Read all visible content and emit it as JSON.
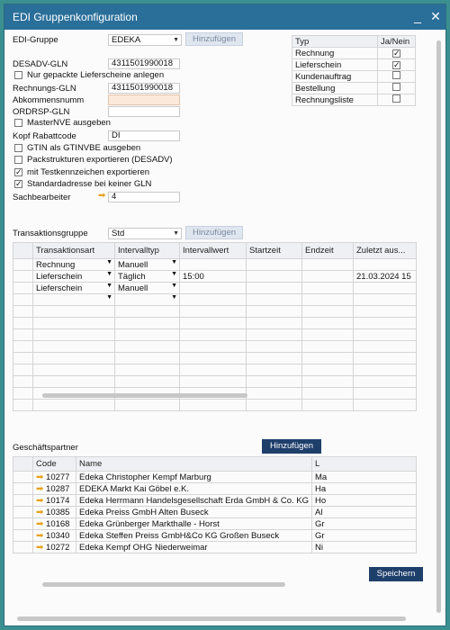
{
  "window": {
    "title": "EDI Gruppenkonfiguration",
    "minimize_glyph": "_",
    "close_glyph": "✕"
  },
  "form": {
    "edi_gruppe_label": "EDI-Gruppe",
    "edi_gruppe_value": "EDEKA",
    "hinzufuegen1": "Hinzufügen",
    "desadv_label": "DESADV-GLN",
    "desadv_value": "4311501990018",
    "nur_gepackte": "Nur gepackte Lieferscheine anlegen",
    "rechnungs_label": "Rechnungs-GLN",
    "rechnungs_value": "4311501990018",
    "abkommen_label": "Abkommensnumm",
    "abkommen_value": "",
    "ordrsp_label": "ORDRSP-GLN",
    "ordrsp_value": "",
    "masternve": "MasterNVE ausgeben",
    "kopf_label": "Kopf Rabattcode",
    "kopf_value": "DI",
    "gtin": "GTIN als GTINVBE ausgeben",
    "packstrukturen": "Packstrukturen exportieren (DESADV)",
    "testkennzeichen": "mit Testkennzeichen exportieren",
    "standardadresse": "Standardadresse bei keiner GLN",
    "sachbearbeiter_label": "Sachbearbeiter",
    "sachbearbeiter_value": "4"
  },
  "typ_table": {
    "headers": [
      "Typ",
      "Ja/Nein"
    ],
    "rows": [
      {
        "typ": "Rechnung",
        "check": "✓"
      },
      {
        "typ": "Lieferschein",
        "check": "✓"
      },
      {
        "typ": "Kundenauftrag",
        "check": ""
      },
      {
        "typ": "Bestellung",
        "check": ""
      },
      {
        "typ": "Rechnungsliste",
        "check": ""
      }
    ]
  },
  "transaktion": {
    "label": "Transaktionsgruppe",
    "value": "Std",
    "hinzufuegen": "Hinzufügen",
    "headers": [
      "Transaktionsart",
      "Intervalltyp",
      "Intervallwert",
      "Startzeit",
      "Endzeit",
      "Zuletzt aus..."
    ],
    "rows": [
      [
        "Rechnung",
        "Manuell",
        "",
        "",
        "",
        ""
      ],
      [
        "Lieferschein",
        "Täglich",
        "15:00",
        "",
        "",
        "21.03.2024 15"
      ],
      [
        "Lieferschein",
        "Manuell",
        "",
        "",
        "",
        ""
      ],
      [
        "",
        "",
        "",
        "",
        "",
        ""
      ]
    ]
  },
  "partner": {
    "label": "Geschäftspartner",
    "hinzufuegen": "Hinzufügen",
    "headers": [
      "Code",
      "Name",
      "L"
    ],
    "rows": [
      [
        "10277",
        "Edeka Christopher Kempf Marburg",
        "Ma"
      ],
      [
        "10287",
        "EDEKA Markt Kai Göbel e.K.",
        "Ha"
      ],
      [
        "10174",
        "Edeka Herrmann Handelsgesellschaft Erda GmbH & Co. KG",
        "Ho"
      ],
      [
        "10385",
        "Edeka Preiss GmbH Alten Buseck",
        "Al"
      ],
      [
        "10168",
        "Edeka Grünberger Markthalle -  Horst",
        "Gr"
      ],
      [
        "10340",
        "Edeka Steffen Preiss GmbH&Co KG Großen Buseck",
        "Gr"
      ],
      [
        "10272",
        "Edeka Kempf OHG Niederweimar",
        "Ni"
      ]
    ]
  },
  "speichern": "Speichern"
}
